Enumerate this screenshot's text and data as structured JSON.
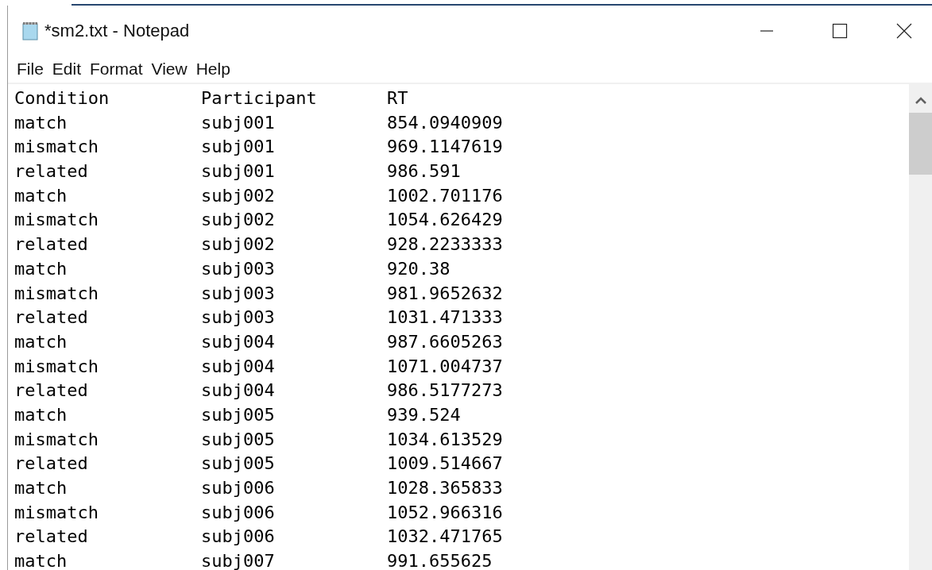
{
  "window": {
    "title": "*sm2.txt - Notepad"
  },
  "menu": [
    "File",
    "Edit",
    "Format",
    "View",
    "Help"
  ],
  "editor": {
    "lines": [
      [
        "Condition",
        "Participant",
        "RT"
      ],
      [
        "match",
        "subj001",
        "854.0940909"
      ],
      [
        "mismatch",
        "subj001",
        "969.1147619"
      ],
      [
        "related",
        "subj001",
        "986.591"
      ],
      [
        "match",
        "subj002",
        "1002.701176"
      ],
      [
        "mismatch",
        "subj002",
        "1054.626429"
      ],
      [
        "related",
        "subj002",
        "928.2233333"
      ],
      [
        "match",
        "subj003",
        "920.38"
      ],
      [
        "mismatch",
        "subj003",
        "981.9652632"
      ],
      [
        "related",
        "subj003",
        "1031.471333"
      ],
      [
        "match",
        "subj004",
        "987.6605263"
      ],
      [
        "mismatch",
        "subj004",
        "1071.004737"
      ],
      [
        "related",
        "subj004",
        "986.5177273"
      ],
      [
        "match",
        "subj005",
        "939.524"
      ],
      [
        "mismatch",
        "subj005",
        "1034.613529"
      ],
      [
        "related",
        "subj005",
        "1009.514667"
      ],
      [
        "match",
        "subj006",
        "1028.365833"
      ],
      [
        "mismatch",
        "subj006",
        "1052.966316"
      ],
      [
        "related",
        "subj006",
        "1032.471765"
      ],
      [
        "match",
        "subj007",
        "991.655625"
      ]
    ]
  }
}
